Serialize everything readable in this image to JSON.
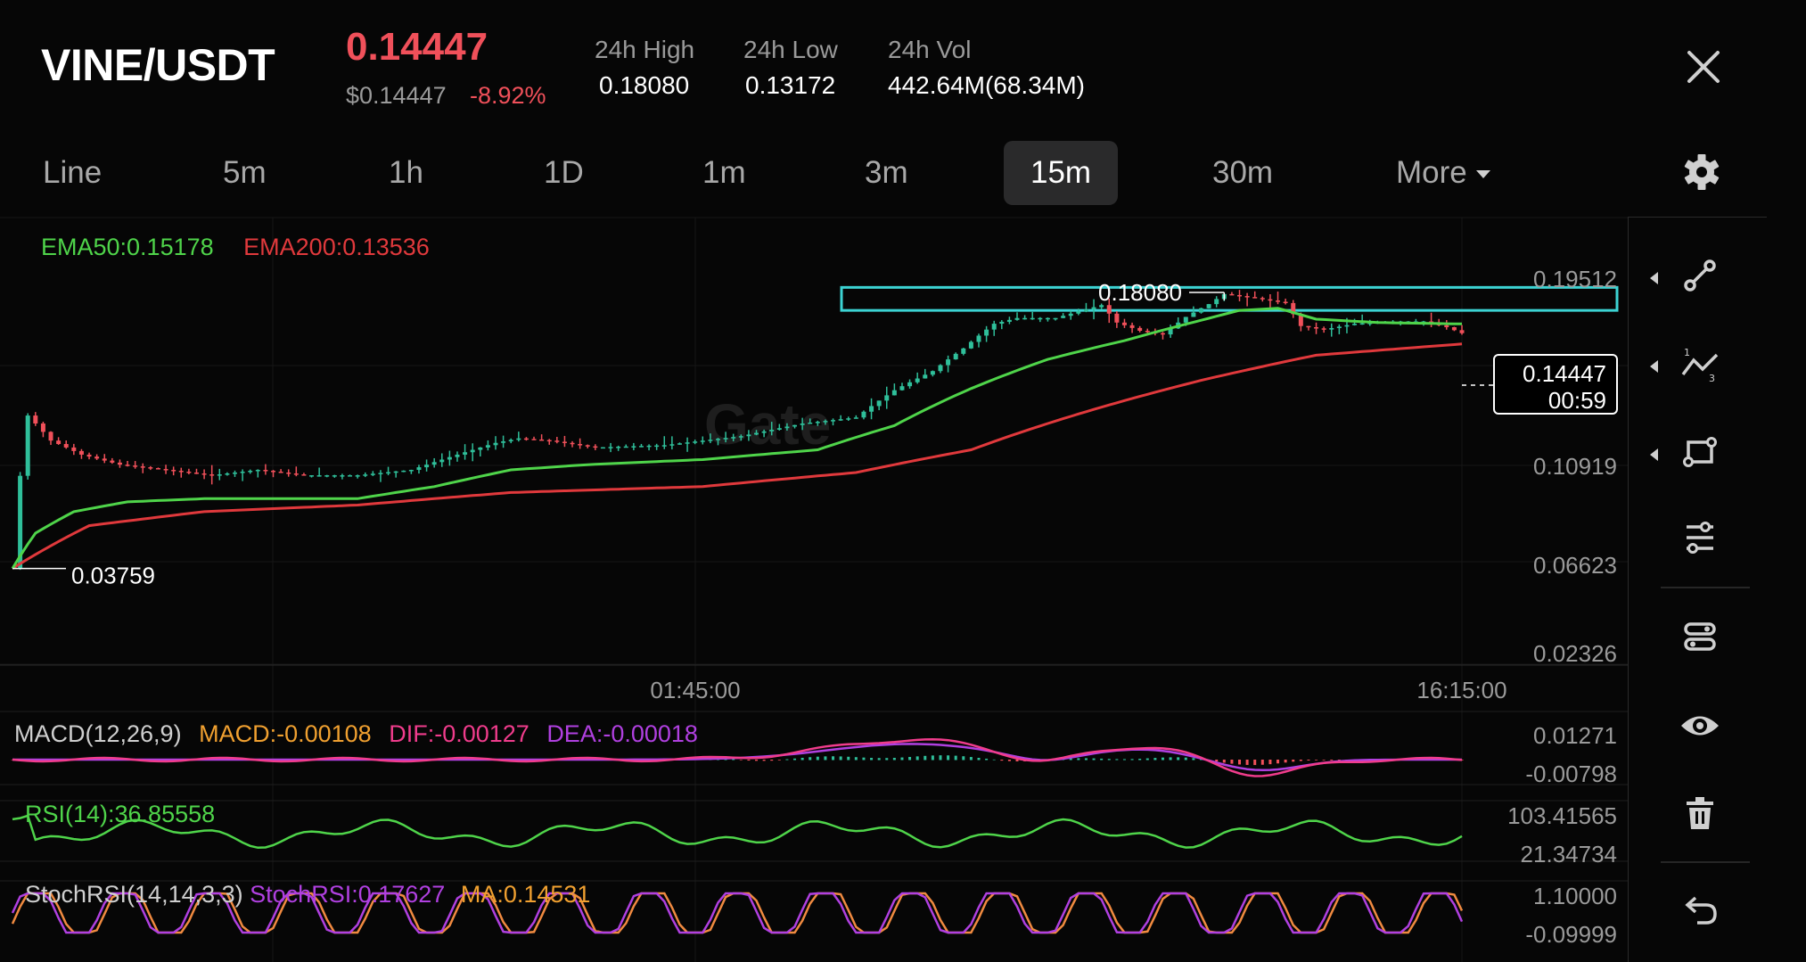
{
  "header": {
    "pair": "VINE/USDT",
    "last_price": "0.14447",
    "usd_price": "$0.14447",
    "change_pct": "-8.92%",
    "stats": [
      {
        "label": "24h High",
        "value": "0.18080"
      },
      {
        "label": "24h Low",
        "value": "0.13172"
      },
      {
        "label": "24h Vol",
        "value": "442.64M(68.34M)"
      }
    ]
  },
  "tabs": [
    {
      "label": "Line",
      "active": false
    },
    {
      "label": "5m",
      "active": false
    },
    {
      "label": "1h",
      "active": false
    },
    {
      "label": "1D",
      "active": false
    },
    {
      "label": "1m",
      "active": false
    },
    {
      "label": "3m",
      "active": false
    },
    {
      "label": "15m",
      "active": true
    },
    {
      "label": "30m",
      "active": false
    },
    {
      "label": "More",
      "active": false,
      "dropdown": true
    }
  ],
  "colors": {
    "up": "#2fbf9a",
    "down": "#f0505a",
    "ema50": "#4fd44a",
    "ema200": "#e0393c",
    "rect": "#3cd3d3",
    "macd": "#f0a030",
    "dif": "#f03c8c",
    "dea": "#b040e0",
    "rsi": "#4fd44a",
    "stoch_k": "#b040e0",
    "stoch_d": "#f08a40",
    "axis_text": "#9a9a9a"
  },
  "watermark": "Gate",
  "main_legend": {
    "ema50": "EMA50:0.15178",
    "ema200": "EMA200:0.13536"
  },
  "annotations": {
    "high_label": "0.18080",
    "low_label": "0.03759",
    "price_tag": "0.14447",
    "countdown": "00:59"
  },
  "indicator_legends": {
    "macd_name": "MACD(12,26,9)",
    "macd": "MACD:-0.00108",
    "dif": "DIF:-0.00127",
    "dea": "DEA:-0.00018",
    "rsi": "RSI(14):36.85558",
    "stoch_name": "StochRSI(14,14,3,3)",
    "stoch_k": "StochRSI:0.17627",
    "stoch_ma": "MA:0.14531"
  },
  "chart_data": {
    "type": "candlestick",
    "symbol": "VINE/USDT",
    "interval": "15m",
    "price_axis_ticks": [
      0.19512,
      0.10919,
      0.06623,
      0.02326
    ],
    "time_axis_ticks": [
      "01:45:00",
      "16:15:00"
    ],
    "overlays": [
      "EMA50",
      "EMA200"
    ],
    "ema50_last": 0.15178,
    "ema200_last": 0.13536,
    "period_high": 0.1808,
    "period_low": 0.03759,
    "current_price": 0.14447,
    "resistance_zone": [
      0.164,
      0.187
    ],
    "price_path": [
      [
        0,
        0.0376
      ],
      [
        2,
        0.09
      ],
      [
        5,
        0.078
      ],
      [
        9,
        0.072
      ],
      [
        14,
        0.068
      ],
      [
        20,
        0.066
      ],
      [
        26,
        0.064
      ],
      [
        32,
        0.066
      ],
      [
        38,
        0.064
      ],
      [
        45,
        0.064
      ],
      [
        52,
        0.066
      ],
      [
        58,
        0.072
      ],
      [
        63,
        0.077
      ],
      [
        66,
        0.079
      ],
      [
        70,
        0.078
      ],
      [
        76,
        0.075
      ],
      [
        85,
        0.076
      ],
      [
        95,
        0.08
      ],
      [
        103,
        0.086
      ],
      [
        110,
        0.089
      ],
      [
        115,
        0.104
      ],
      [
        120,
        0.116
      ],
      [
        124,
        0.132
      ],
      [
        128,
        0.152
      ],
      [
        131,
        0.157
      ],
      [
        136,
        0.157
      ],
      [
        140,
        0.165
      ],
      [
        142,
        0.169
      ],
      [
        144,
        0.153
      ],
      [
        147,
        0.146
      ],
      [
        150,
        0.143
      ],
      [
        153,
        0.158
      ],
      [
        156,
        0.17
      ],
      [
        158,
        0.18
      ],
      [
        162,
        0.176
      ],
      [
        166,
        0.171
      ],
      [
        168,
        0.15
      ],
      [
        171,
        0.147
      ],
      [
        175,
        0.152
      ],
      [
        180,
        0.154
      ],
      [
        184,
        0.154
      ],
      [
        187,
        0.149
      ],
      [
        189,
        0.144
      ]
    ],
    "ema50_path": [
      [
        0,
        0.0376
      ],
      [
        3,
        0.046
      ],
      [
        8,
        0.052
      ],
      [
        15,
        0.055
      ],
      [
        25,
        0.056
      ],
      [
        35,
        0.056
      ],
      [
        45,
        0.056
      ],
      [
        55,
        0.06
      ],
      [
        65,
        0.066
      ],
      [
        75,
        0.068
      ],
      [
        90,
        0.07
      ],
      [
        105,
        0.074
      ],
      [
        115,
        0.085
      ],
      [
        125,
        0.105
      ],
      [
        135,
        0.124
      ],
      [
        145,
        0.138
      ],
      [
        155,
        0.155
      ],
      [
        160,
        0.164
      ],
      [
        165,
        0.166
      ],
      [
        170,
        0.156
      ],
      [
        178,
        0.153
      ],
      [
        189,
        0.1518
      ]
    ],
    "ema200_path": [
      [
        0,
        0.0376
      ],
      [
        10,
        0.048
      ],
      [
        25,
        0.052
      ],
      [
        45,
        0.054
      ],
      [
        65,
        0.058
      ],
      [
        90,
        0.06
      ],
      [
        110,
        0.065
      ],
      [
        125,
        0.074
      ],
      [
        140,
        0.092
      ],
      [
        155,
        0.11
      ],
      [
        170,
        0.127
      ],
      [
        189,
        0.1354
      ]
    ],
    "macd": {
      "axis_ticks": [
        0.01271,
        -0.00798
      ],
      "macd": -0.00108,
      "dif": -0.00127,
      "dea": -0.00018
    },
    "rsi": {
      "axis_ticks": [
        103.41565,
        21.34734
      ],
      "value": 36.85558
    },
    "stochrsi": {
      "axis_ticks": [
        1.1,
        -0.09999
      ],
      "k": 0.17627,
      "ma": 0.14531
    }
  },
  "toolbar": {
    "tools": [
      "line-tool-icon",
      "fib-tool-icon",
      "shape-tool-icon",
      "indicator-settings-icon",
      "layers-icon",
      "visibility-icon",
      "trash-icon",
      "undo-icon"
    ]
  }
}
